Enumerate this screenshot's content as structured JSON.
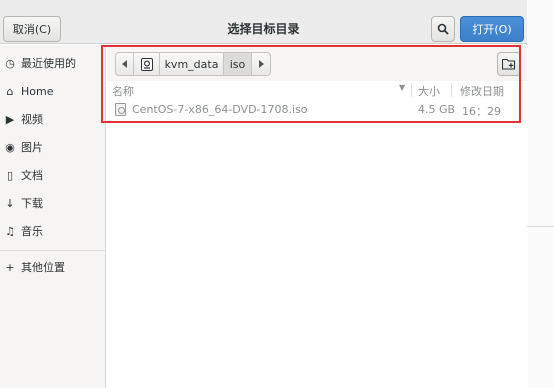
{
  "header": {
    "cancel_label": "取消(C)",
    "title": "选择目标目录",
    "open_label": "打开(O)"
  },
  "sidebar": {
    "items": [
      {
        "label": "最近使用的",
        "icon": "clock-icon",
        "glyph": "◷"
      },
      {
        "label": "Home",
        "icon": "home-icon",
        "glyph": "⌂"
      },
      {
        "label": "视频",
        "icon": "video-icon",
        "glyph": "▶"
      },
      {
        "label": "图片",
        "icon": "camera-icon",
        "glyph": "◉"
      },
      {
        "label": "文档",
        "icon": "document-icon",
        "glyph": "▯"
      },
      {
        "label": "下载",
        "icon": "download-icon",
        "glyph": "↓"
      },
      {
        "label": "音乐",
        "icon": "music-icon",
        "glyph": "♫"
      },
      {
        "label": "其他位置",
        "icon": "plus-icon",
        "glyph": "+"
      }
    ]
  },
  "pathbar": {
    "segments": [
      "kvm_data",
      "iso"
    ]
  },
  "columns": {
    "name": "名称",
    "size": "大小",
    "date": "修改日期"
  },
  "files": [
    {
      "name": "CentOS-7-x86_64-DVD-1708.iso",
      "size": "4.5 GB",
      "date": "16：29"
    }
  ],
  "colors": {
    "accent": "#4a90d9",
    "highlight_box": "#e03434"
  }
}
